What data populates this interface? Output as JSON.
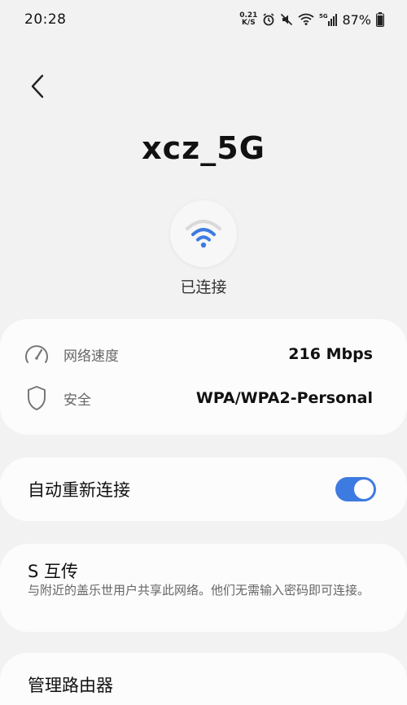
{
  "status_bar": {
    "time": "20:28",
    "net_speed_value": "0.21",
    "net_speed_unit": "K/S",
    "battery_percent": "87%",
    "icons": [
      "net-speed-icon",
      "alarm-icon",
      "mute-icon",
      "wifi-status-icon",
      "5g-signal-icon",
      "battery-icon"
    ]
  },
  "header": {
    "back_icon": "chevron-left-icon",
    "ssid": "xcz_5G"
  },
  "connection": {
    "icon": "wifi-icon",
    "status": "已连接",
    "accent_color": "#3e7be0"
  },
  "info": {
    "speed": {
      "icon": "speedometer-icon",
      "label": "网络速度",
      "value": "216 Mbps"
    },
    "security": {
      "icon": "shield-icon",
      "label": "安全",
      "value": "WPA/WPA2-Personal"
    }
  },
  "reconnect": {
    "label": "自动重新连接",
    "enabled": true
  },
  "share": {
    "title": "S 互传",
    "description": "与附近的盖乐世用户共享此网络。他们无需输入密码即可连接。"
  },
  "router": {
    "label": "管理路由器"
  }
}
